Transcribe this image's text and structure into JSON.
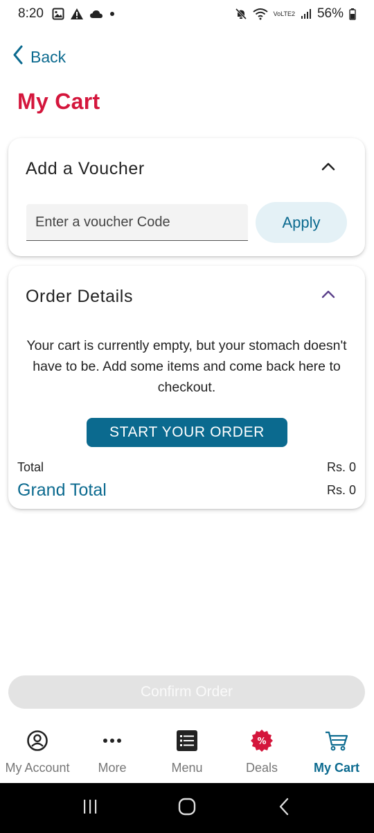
{
  "status_bar": {
    "time": "8:20",
    "battery": "56%",
    "network": "VoLTE2"
  },
  "header": {
    "back_label": "Back",
    "title": "My Cart"
  },
  "voucher": {
    "title": "Add a Voucher",
    "input_placeholder": "Enter a voucher Code",
    "input_value": "",
    "apply_label": "Apply"
  },
  "order_details": {
    "title": "Order Details",
    "empty_message": "Your cart is currently empty, but your stomach doesn't have to be. Add some items and come back here to checkout.",
    "start_order_label": "START YOUR ORDER",
    "total_label": "Total",
    "total_value": "Rs. 0",
    "grand_total_label": "Grand Total",
    "grand_total_value": "Rs. 0"
  },
  "confirm_label": "Confirm Order",
  "bottom_nav": {
    "items": [
      {
        "label": "My Account",
        "icon": "account-icon",
        "active": false
      },
      {
        "label": "More",
        "icon": "more-dots-icon",
        "active": false
      },
      {
        "label": "Menu",
        "icon": "menu-list-icon",
        "active": false
      },
      {
        "label": "Deals",
        "icon": "deals-percent-icon",
        "active": false
      },
      {
        "label": "My Cart",
        "icon": "cart-icon",
        "active": true
      }
    ]
  },
  "colors": {
    "brand_red": "#d4163c",
    "primary_teal": "#0b6a8f",
    "apply_bg": "#e4f1f6",
    "confirm_disabled_bg": "#e3e3e3"
  }
}
